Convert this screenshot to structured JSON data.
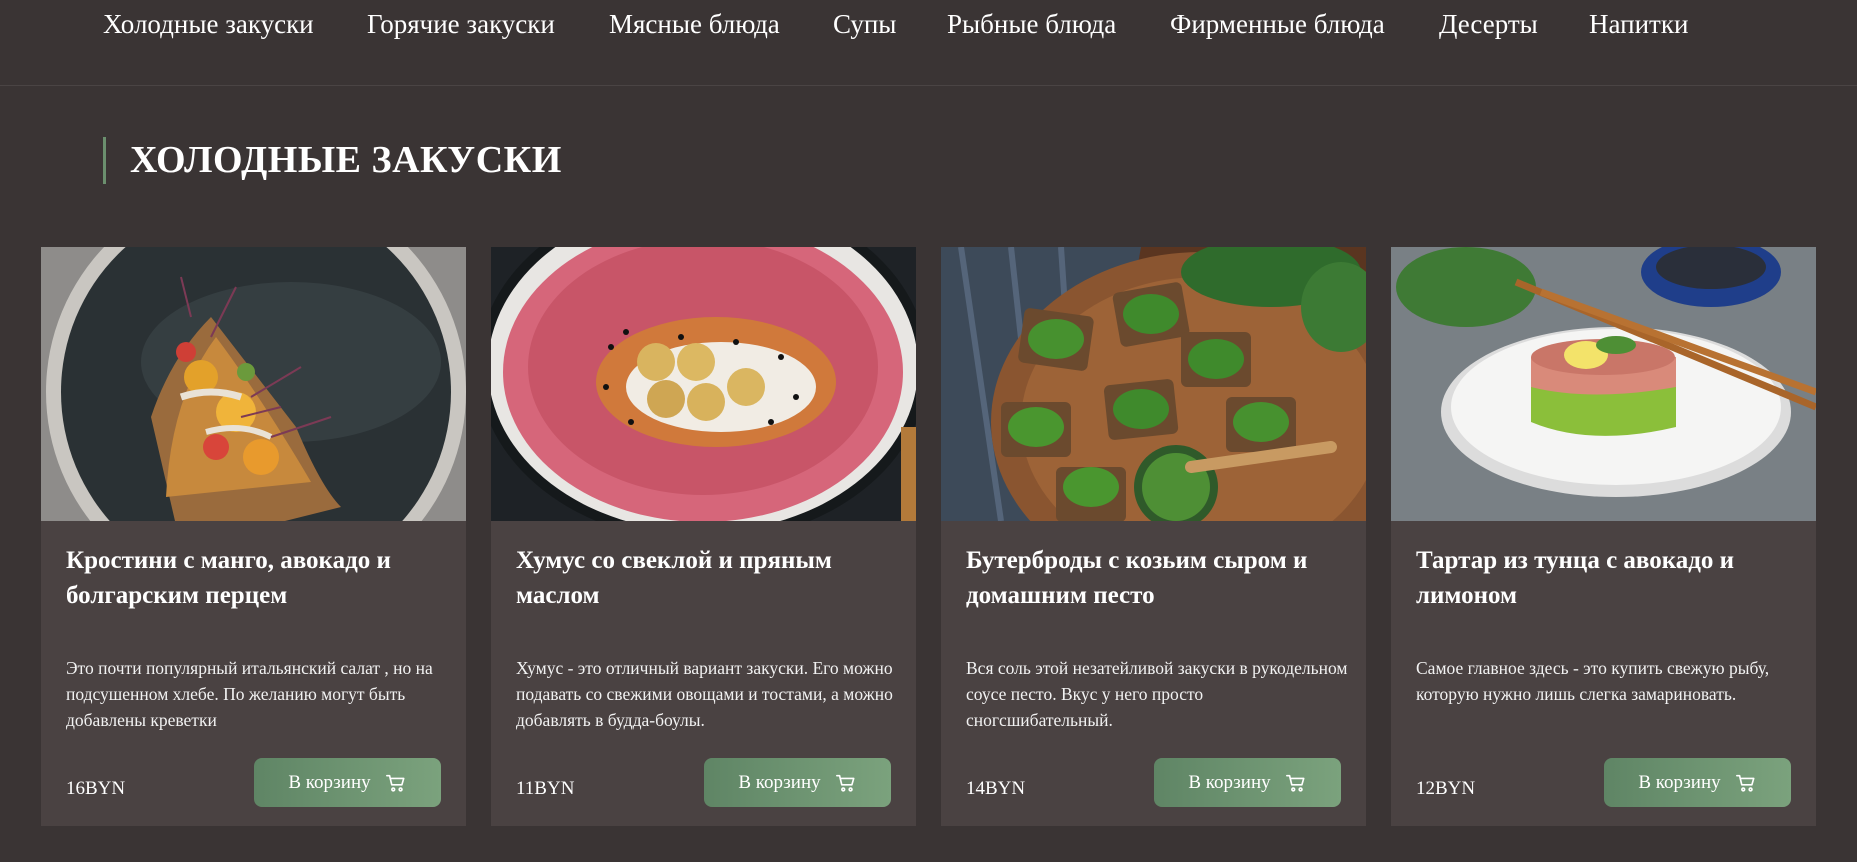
{
  "nav": {
    "items": [
      {
        "label": "Холодные закуски"
      },
      {
        "label": "Горячие закуски"
      },
      {
        "label": "Мясные блюда"
      },
      {
        "label": "Супы"
      },
      {
        "label": "Рыбные блюда"
      },
      {
        "label": "Фирменные блюда"
      },
      {
        "label": "Десерты"
      },
      {
        "label": "Напитки"
      }
    ]
  },
  "section": {
    "title": "ХОЛОДНЫЕ ЗАКУСКИ"
  },
  "colors": {
    "background": "#3a3434",
    "card": "#4a4242",
    "accent": "#6b8f6e",
    "button_start": "#5f8565",
    "button_end": "#7ba27d"
  },
  "products": [
    {
      "name": "Кростини с манго, авокадо и болгарским перцем",
      "description": "Это почти популярный итальянский салат , но на подсушенном хлебе. По желанию могут быть добавлены креветки",
      "price": "16BYN",
      "button_label": "В корзину",
      "image": "crostini-photo"
    },
    {
      "name": "Хумус со свеклой и пряным маслом",
      "description": "Хумус - это отличный вариант закуски. Его можно подавать со свежими овощами и тостами, а можно добавлять в будда-боулы.",
      "price": "11BYN",
      "button_label": "В корзину",
      "image": "hummus-photo"
    },
    {
      "name": "Бутерброды с козьим сыром и домашним песто",
      "description": "Вся соль этой незатейливой закуски в рукодельном соусе песто. Вкус у него просто сногсшибательный.",
      "price": "14BYN",
      "button_label": "В корзину",
      "image": "pesto-sandwiches-photo"
    },
    {
      "name": "Тартар из тунца с авокадо и лимоном",
      "description": "Самое главное здесь - это купить свежую рыбу, которую нужно лишь слегка замариновать.",
      "price": "12BYN",
      "button_label": "В корзину",
      "image": "tuna-tartare-photo"
    }
  ]
}
